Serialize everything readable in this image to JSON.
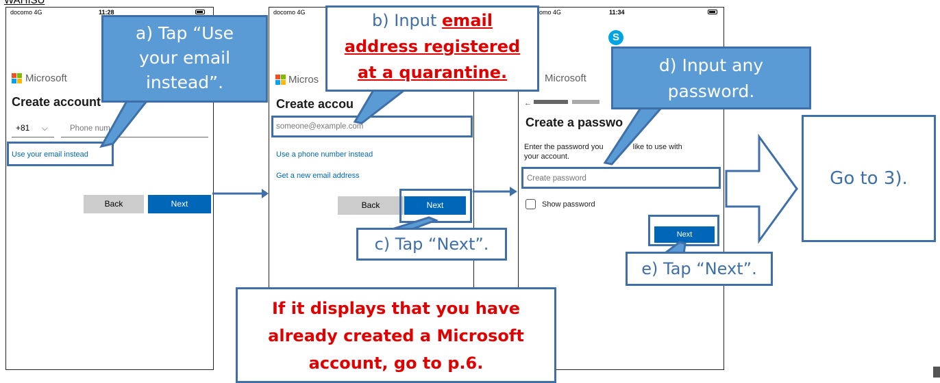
{
  "header_fragment": "WAHISU",
  "phone1": {
    "carrier": "docomo 4G",
    "time": "11:28",
    "ms_brand": "Microsoft",
    "title": "Create account",
    "country_code": "+81",
    "phone_placeholder": "Phone num",
    "email_link": "Use your email instead",
    "back": "Back",
    "next": "Next"
  },
  "phone2": {
    "carrier": "docomo 4G",
    "ms_brand": "Micros",
    "title": "Create accou",
    "email_placeholder": "someone@example.com",
    "phone_link": "Use a phone number instead",
    "new_email_link": "Get a new email address",
    "back": "Back",
    "next": "Next"
  },
  "phone3": {
    "carrier": "omo 4G",
    "time": "11:34",
    "ms_brand": "Microsoft",
    "title": "Create a passwo",
    "desc1": "Enter the password you",
    "desc1b": "like to use with",
    "desc2": "your account.",
    "password_placeholder": "Create password",
    "show_password": "Show password",
    "next": "Next"
  },
  "callouts": {
    "a_line1": "a) Tap “Use",
    "a_line2": "your email",
    "a_line3": "instead”.",
    "b_line1": "b) Input",
    "b_red1": "email",
    "b_red2": "address registered",
    "b_red3": "at a quarantine.",
    "c": "c) Tap “Next”.",
    "d_line1": "d) Input any",
    "d_line2": "password.",
    "e": "e) Tap “Next”.",
    "go": "Go to 3).",
    "warn1": "If it displays that you have",
    "warn2": "already created a Microsoft",
    "warn3": "account, go to p.6."
  },
  "colors": {
    "callout_fill": "#5b9bd5",
    "callout_border": "#3f6fa8",
    "ms_blue": "#0067b8",
    "warn_red": "#e00000"
  }
}
